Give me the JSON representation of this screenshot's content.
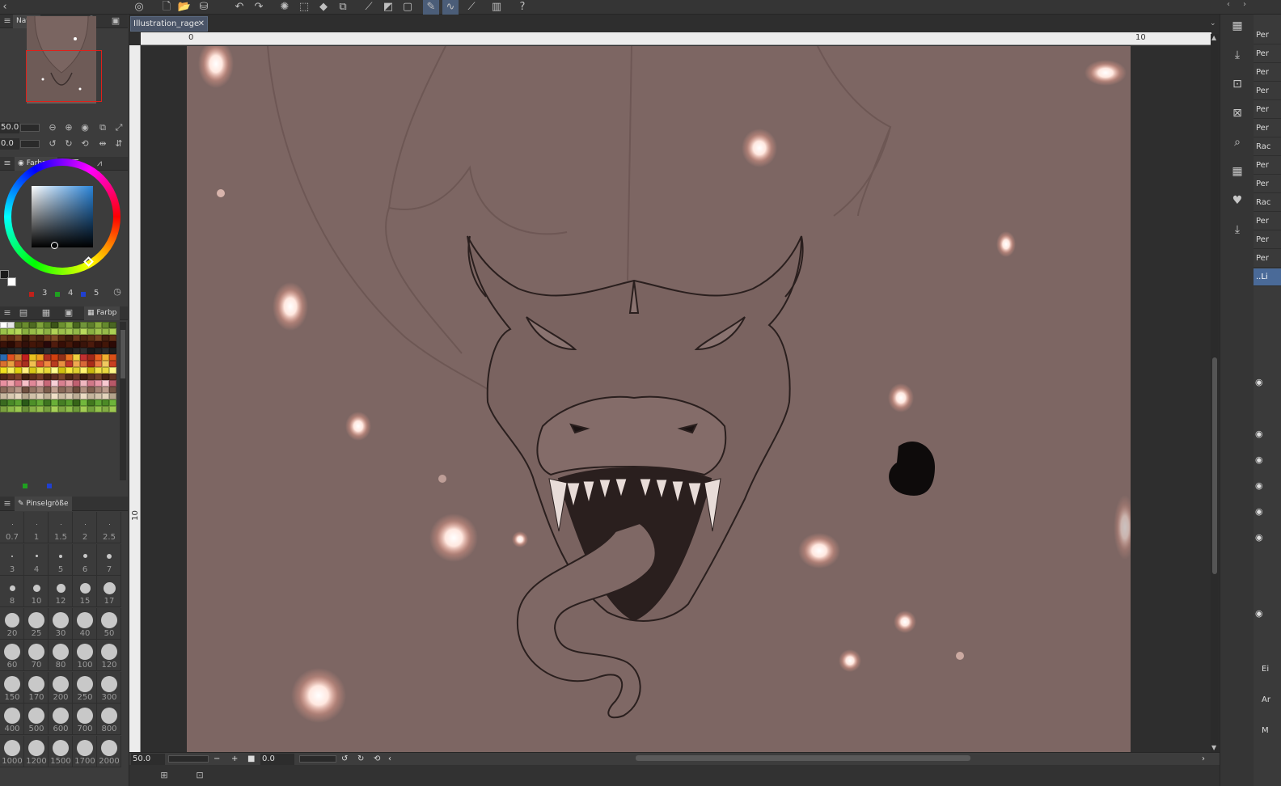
{
  "document": {
    "tab_title": "Illustration_rage",
    "close_glyph": "✕"
  },
  "navigator": {
    "tab_label": "Navig",
    "zoom_value": "50.0",
    "rotation_value": "0.0"
  },
  "color_panel": {
    "tab_label": "Farbrad",
    "swatch_counts": [
      "3",
      "4",
      "5"
    ]
  },
  "palette_panel": {
    "tab_label": "Farbp"
  },
  "brush_panel": {
    "tab_label": "Pinselgröße",
    "sizes": [
      "0.7",
      "1",
      "1.5",
      "2",
      "2.5",
      "3",
      "4",
      "5",
      "6",
      "7",
      "8",
      "10",
      "12",
      "15",
      "17",
      "20",
      "25",
      "30",
      "40",
      "50",
      "60",
      "70",
      "80",
      "100",
      "120",
      "150",
      "170",
      "200",
      "250",
      "300",
      "400",
      "500",
      "600",
      "700",
      "800",
      "1000",
      "1200",
      "1500",
      "1700",
      "2000"
    ]
  },
  "rulers": {
    "top_start": "0",
    "top_mark": "10",
    "left_mark": "10"
  },
  "status": {
    "zoom": "50.0",
    "rotation": "0.0"
  },
  "layers": [
    "Per",
    "Per",
    "Per",
    "Per",
    "Per",
    "Per",
    "Rac",
    "Per",
    "Per",
    "Rac",
    "Per",
    "Per",
    "Per",
    "..Li"
  ],
  "side_labels": [
    "Ei",
    "Ar",
    "M"
  ],
  "colors": {
    "canvas_bg": "#7d6663",
    "accent": "#4a6a98",
    "nav_frame": "#e0201a"
  }
}
